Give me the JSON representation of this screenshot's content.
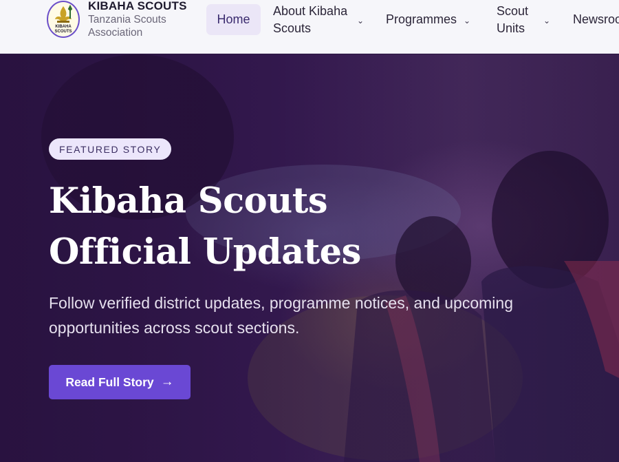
{
  "brand": {
    "title": "KIBAHA SCOUTS",
    "subtitle_line1": "Tanzania Scouts",
    "subtitle_line2": "Association",
    "logo_text": "KIBAHA SCOUTS"
  },
  "nav": {
    "home": "Home",
    "about_line1": "About Kibaha",
    "about_line2": "Scouts",
    "programmes": "Programmes",
    "units_line1": "Scout",
    "units_line2": "Units",
    "newsroom": "Newsroom",
    "chevron": "chevron-down-icon"
  },
  "hero": {
    "badge": "FEATURED STORY",
    "headline_line1": "Kibaha Scouts",
    "headline_line2": "Official Updates",
    "lede_line1": "Follow verified district updates, programme notices, and upcoming",
    "lede_line2": "opportunities across scout sections.",
    "cta_label": "Read Full Story",
    "cta_icon": "arrow-right-icon"
  },
  "colors": {
    "accent": "#6a48d4",
    "badge_bg": "#ece6fb",
    "header_bg": "#f6f6fa",
    "hero_bg": "#2a1540"
  }
}
